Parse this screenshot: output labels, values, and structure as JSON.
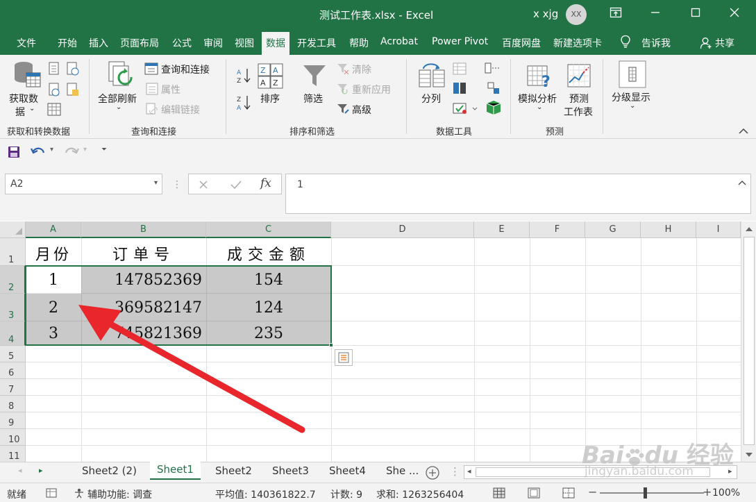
{
  "app": {
    "title": "测试工作表.xlsx  -  Excel",
    "user": "x xjg",
    "avatar": "XX"
  },
  "tabs": [
    "文件",
    "开始",
    "插入",
    "页面布局",
    "公式",
    "审阅",
    "视图",
    "数据",
    "开发工具",
    "帮助",
    "Acrobat",
    "Power Pivot",
    "百度网盘",
    "新建选项卡"
  ],
  "tell_me": "告诉我",
  "share": "共享",
  "ribbon": {
    "get_data": "获取数",
    "get_data2": "据",
    "group_get_transform": "获取和转换数据",
    "refresh_all": "全部刷新",
    "queries_connections": "查询和连接",
    "properties": "属性",
    "edit_links": "编辑链接",
    "group_queries": "查询和连接",
    "sort": "排序",
    "filter": "筛选",
    "clear": "清除",
    "reapply": "重新应用",
    "advanced": "高级",
    "group_sort_filter": "排序和筛选",
    "text_to_columns": "分列",
    "group_data_tools": "数据工具",
    "what_if": "模拟分析",
    "forecast_sheet": "预测",
    "forecast_sheet2": "工作表",
    "group_forecast": "预测",
    "outline": "分级显示"
  },
  "formula_bar": {
    "name_box": "A2",
    "formula": "1"
  },
  "columns": [
    "A",
    "B",
    "C",
    "D",
    "E",
    "F",
    "G",
    "H",
    "I"
  ],
  "rows": [
    "1",
    "2",
    "3",
    "4",
    "5",
    "6",
    "7",
    "8",
    "9",
    "10",
    "11"
  ],
  "table": {
    "headers": [
      "月份",
      "订单号",
      "成交金额"
    ],
    "rows": [
      [
        "1",
        "147852369",
        "154"
      ],
      [
        "2",
        "369582147",
        "124"
      ],
      [
        "3",
        "745821369",
        "235"
      ]
    ]
  },
  "sheets": [
    "Sheet2 (2)",
    "Sheet1",
    "Sheet2",
    "Sheet3",
    "Sheet4",
    "She ..."
  ],
  "status": {
    "mode": "就绪",
    "accessibility": "辅助功能: 调查",
    "average": "平均值: 140361822.7",
    "count": "计数: 9",
    "sum": "求和: 1263256404",
    "zoom": "100%"
  },
  "watermark": {
    "brand": "Bai",
    "brand2": "du",
    "brand_cn": "经验",
    "url": "jingyan.baidu.com"
  },
  "colors": {
    "excel_green": "#217346",
    "ribbon_bg": "#f3f3f3",
    "selection_shade": "#c9c9c9",
    "arrow_red": "#e8262b"
  },
  "icons": [
    "restore-ribbon-icon",
    "minimize-icon",
    "maximize-icon",
    "close-icon",
    "lightbulb-icon",
    "person-icon",
    "save-icon",
    "undo-icon",
    "redo-icon",
    "quick-analysis-icon"
  ]
}
